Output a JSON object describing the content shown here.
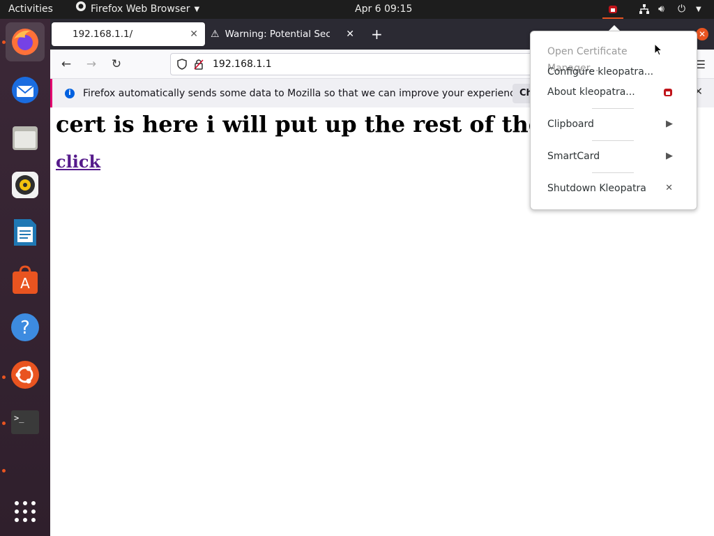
{
  "topbar": {
    "activities": "Activities",
    "app_name": "Firefox Web Browser",
    "clock": "Apr 6  09:15"
  },
  "dock": {
    "items": [
      "firefox",
      "thunderbird",
      "files",
      "rhythmbox",
      "libreoffice-writer",
      "app-center",
      "help",
      "ubuntu-software",
      "terminal",
      "show-applications"
    ]
  },
  "browser": {
    "tabs": [
      {
        "title": "192.168.1.1/"
      },
      {
        "title": "Warning: Potential Security Risk Ahead"
      }
    ],
    "new_tab_label": "+",
    "url": "192.168.1.1",
    "notification": {
      "text": "Firefox automatically sends some data to Mozilla so that we can improve your experience.",
      "button": "Choose What I Share"
    }
  },
  "page": {
    "heading": "cert is here i will put up the rest of the",
    "link": "click"
  },
  "tray_menu": {
    "items": [
      {
        "label": "Open Certificate Manager...",
        "enabled": false
      },
      {
        "label": "Configure kleopatra...",
        "enabled": true
      },
      {
        "label": "About kleopatra...",
        "enabled": true
      },
      {
        "label": "Clipboard",
        "enabled": true
      },
      {
        "label": "SmartCard",
        "enabled": true
      },
      {
        "label": "Shutdown Kleopatra",
        "enabled": true
      }
    ]
  },
  "colors": {
    "accent": "#e95420",
    "topbar": "#1d1d1d",
    "dock": "#3b2837",
    "link": "#551a8b"
  }
}
